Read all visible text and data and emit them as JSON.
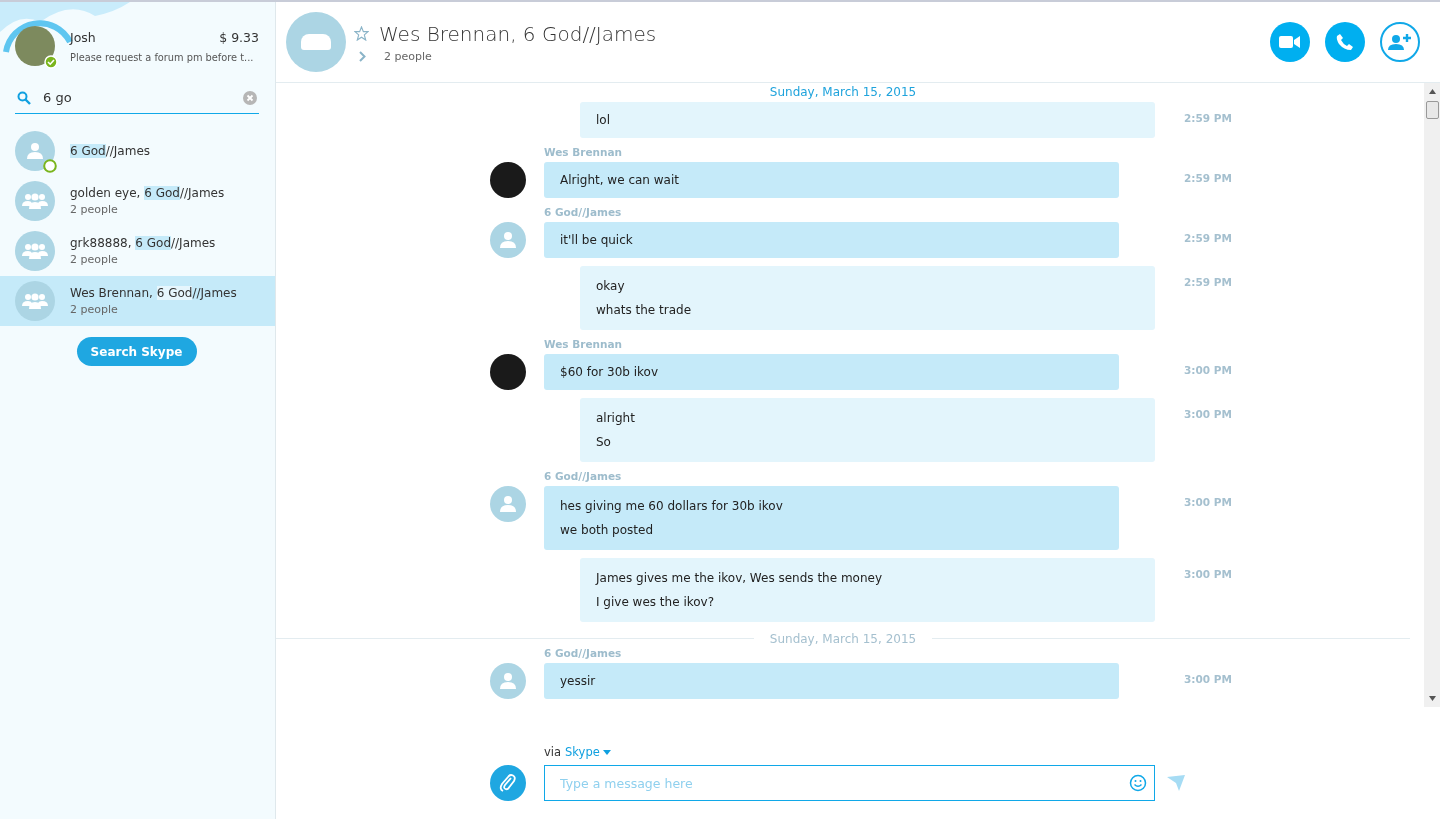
{
  "profile": {
    "name": "Josh",
    "credit": "$ 9.33",
    "mood": "Please request a forum pm before t...",
    "online": true
  },
  "search": {
    "value": "6 go"
  },
  "contacts": [
    {
      "kind": "person",
      "match": "6 God",
      "after": "//James",
      "presence_ring": true,
      "selected": false
    },
    {
      "kind": "group",
      "before": "golden eye, ",
      "match": "6 God",
      "after": "//James",
      "subtitle": "2 people",
      "presence_ring": false,
      "selected": false
    },
    {
      "kind": "group",
      "before": "grk88888, ",
      "match": "6 God",
      "after": "//James",
      "subtitle": "2 people",
      "presence_ring": false,
      "selected": false
    },
    {
      "kind": "group",
      "before": "Wes Brennan, ",
      "match": "6 God",
      "after": "//James",
      "subtitle": "2 people",
      "presence_ring": false,
      "selected": true
    }
  ],
  "search_skype_button": "Search Skype",
  "conversation": {
    "title": "Wes Brennan, 6 God//James",
    "subtitle": "2 people",
    "favorite": false
  },
  "items": [
    {
      "kind": "date",
      "sticky": true,
      "text": "Sunday, March 15, 2015"
    },
    {
      "kind": "outgoing",
      "lines": [
        "lol"
      ],
      "time": "2:59 PM"
    },
    {
      "kind": "incoming-photo",
      "sender": "Wes Brennan",
      "lines": [
        "Alright, we can wait"
      ],
      "time": "2:59 PM"
    },
    {
      "kind": "incoming-default",
      "sender": "6 God//James",
      "lines": [
        "it'll be quick"
      ],
      "time": "2:59 PM"
    },
    {
      "kind": "outgoing",
      "lines": [
        "okay",
        "whats the trade"
      ],
      "time": "2:59 PM"
    },
    {
      "kind": "incoming-photo",
      "sender": "Wes Brennan",
      "lines": [
        "$60 for 30b ikov"
      ],
      "time": "3:00 PM"
    },
    {
      "kind": "outgoing",
      "lines": [
        "alright",
        "So"
      ],
      "time": "3:00 PM"
    },
    {
      "kind": "incoming-default",
      "sender": "6 God//James",
      "lines": [
        "hes giving me 60 dollars for 30b ikov",
        "we both posted"
      ],
      "time": "3:00 PM"
    },
    {
      "kind": "outgoing",
      "lines": [
        "James gives me the ikov, Wes sends the money",
        "I give wes the ikov?"
      ],
      "time": "3:00 PM"
    },
    {
      "kind": "date",
      "sticky": false,
      "text": "Sunday, March 15, 2015"
    },
    {
      "kind": "incoming-default",
      "sender": "6 God//James",
      "lines": [
        "yessir"
      ],
      "time": "3:00 PM"
    }
  ],
  "composer": {
    "via": "via",
    "service": "Skype",
    "placeholder": "Type a message here"
  }
}
